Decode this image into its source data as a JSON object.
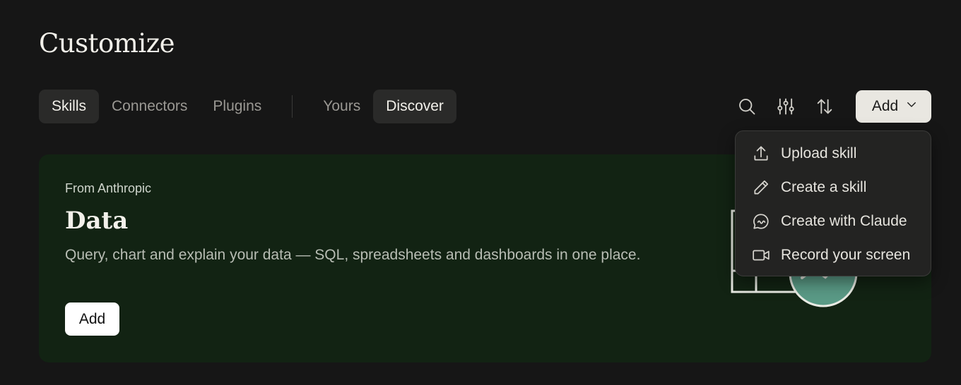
{
  "page": {
    "title": "Customize"
  },
  "tabs": {
    "primary": [
      {
        "label": "Skills",
        "active": true
      },
      {
        "label": "Connectors",
        "active": false
      },
      {
        "label": "Plugins",
        "active": false
      }
    ],
    "filter": [
      {
        "label": "Yours",
        "active": false
      },
      {
        "label": "Discover",
        "active": true
      }
    ]
  },
  "toolbar": {
    "icons": [
      "search-icon",
      "filter-sliders-icon",
      "sort-icon"
    ],
    "add_label": "Add",
    "add_icon": "chevron-down-icon"
  },
  "banner": {
    "eyebrow": "From Anthropic",
    "title": "Data",
    "description": "Query, chart and explain your data — SQL, spreadsheets and dashboards in one place.",
    "add_label": "Add",
    "background_color": "#122313"
  },
  "menu": {
    "items": [
      {
        "label": "Upload skill",
        "icon": "upload-icon"
      },
      {
        "label": "Create a skill",
        "icon": "pencil-icon"
      },
      {
        "label": "Create with Claude",
        "icon": "chat-bubble-icon"
      },
      {
        "label": "Record your screen",
        "icon": "video-camera-icon"
      }
    ]
  }
}
